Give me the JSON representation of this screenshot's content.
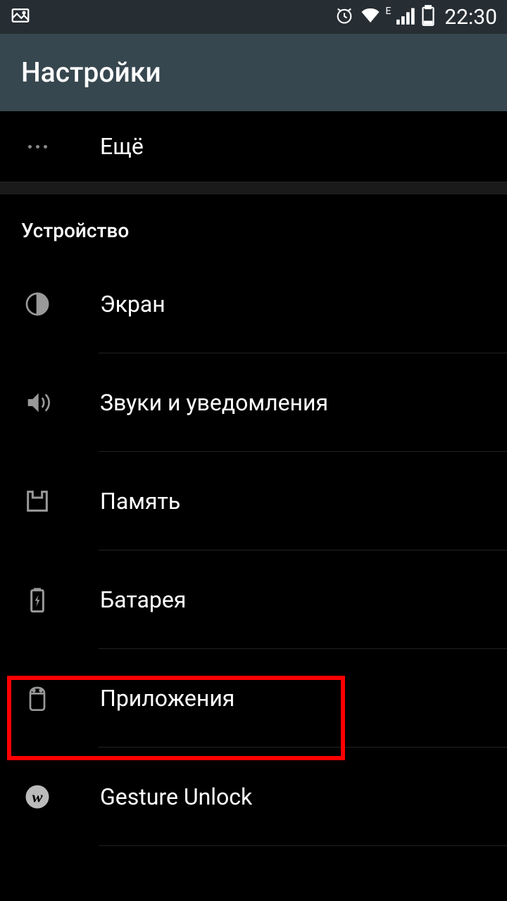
{
  "statusbar": {
    "time": "22:30"
  },
  "header": {
    "title": "Настройки"
  },
  "items": {
    "more": {
      "label": "Ещё"
    },
    "display": {
      "label": "Экран"
    },
    "sound": {
      "label": "Звуки и уведомления"
    },
    "storage": {
      "label": "Память"
    },
    "battery": {
      "label": "Батарея"
    },
    "apps": {
      "label": "Приложения"
    },
    "gesture": {
      "label": "Gesture Unlock"
    }
  },
  "section": {
    "device": "Устройство"
  },
  "network_indicator": "E"
}
